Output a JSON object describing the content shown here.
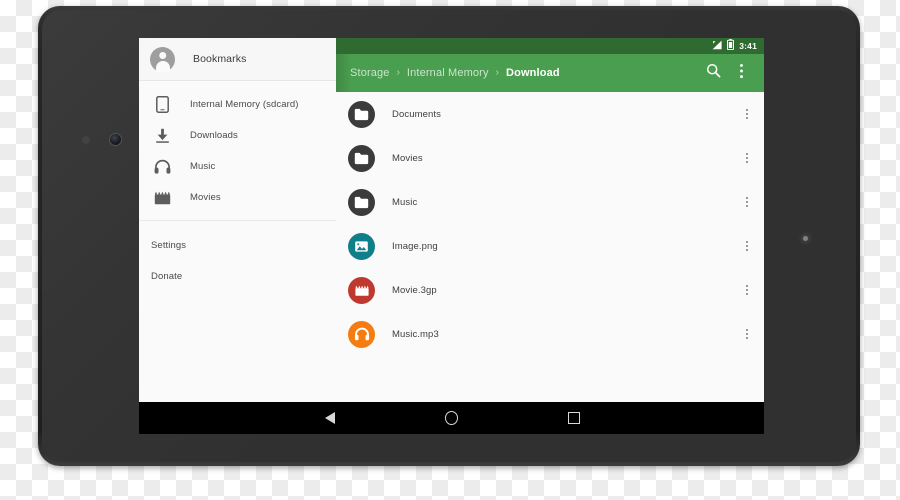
{
  "device": {
    "type": "android-tablet",
    "front_camera": "front-camera",
    "bezel_color": "#242424"
  },
  "statusbar": {
    "time": "3:41",
    "icons": [
      "signal-icon",
      "battery-icon"
    ],
    "background": "#2f6b31"
  },
  "appbar": {
    "background": "#4a9e4f",
    "breadcrumb": [
      {
        "label": "Storage",
        "current": false
      },
      {
        "label": "Internal Memory",
        "current": false
      },
      {
        "label": "Download",
        "current": true
      }
    ],
    "separator": "›",
    "actions": [
      {
        "name": "search-icon",
        "label": "Search"
      },
      {
        "name": "overflow-menu-icon",
        "label": "More options"
      }
    ]
  },
  "sidebar": {
    "header": {
      "label": "Bookmarks",
      "avatar": "account-avatar-icon"
    },
    "items": [
      {
        "label": "Internal Memory (sdcard)",
        "icon": "phone-storage-icon"
      },
      {
        "label": "Downloads",
        "icon": "download-icon"
      },
      {
        "label": "Music",
        "icon": "headphones-icon"
      },
      {
        "label": "Movies",
        "icon": "movie-clapper-icon"
      }
    ],
    "footer_items": [
      {
        "label": "Settings"
      },
      {
        "label": "Donate"
      }
    ]
  },
  "filelist": {
    "overflow_label": "More options",
    "rows": [
      {
        "name": "Documents",
        "icon": "folder-icon",
        "color": "#3b3b3b",
        "type": "folder"
      },
      {
        "name": "Movies",
        "icon": "folder-icon",
        "color": "#3b3b3b",
        "type": "folder"
      },
      {
        "name": "Music",
        "icon": "folder-icon",
        "color": "#3b3b3b",
        "type": "folder"
      },
      {
        "name": "Image.png",
        "icon": "image-file-icon",
        "color": "#0f7f8a",
        "type": "image"
      },
      {
        "name": "Movie.3gp",
        "icon": "video-file-icon",
        "color": "#c0392f",
        "type": "video"
      },
      {
        "name": "Music.mp3",
        "icon": "audio-file-icon",
        "color": "#f57c10",
        "type": "audio"
      }
    ]
  },
  "navbar": {
    "buttons": [
      {
        "name": "nav-back-button",
        "label": "Back"
      },
      {
        "name": "nav-home-button",
        "label": "Home"
      },
      {
        "name": "nav-recents-button",
        "label": "Recents"
      }
    ]
  }
}
